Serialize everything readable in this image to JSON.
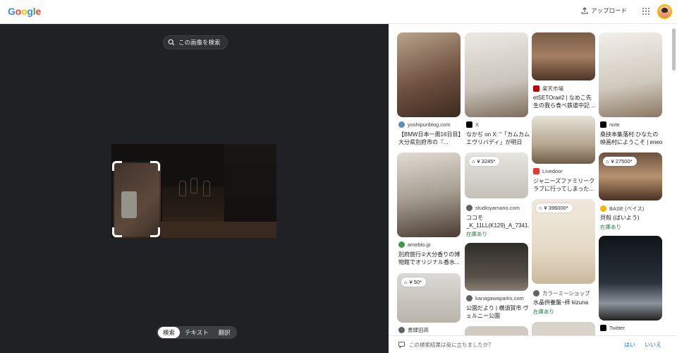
{
  "header": {
    "logo": [
      "G",
      "o",
      "o",
      "g",
      "l",
      "e"
    ],
    "logo_colors": [
      "#4285F4",
      "#EA4335",
      "#FBBC05",
      "#4285F4",
      "#34A853",
      "#EA4335"
    ],
    "upload_label": "アップロード"
  },
  "left_panel": {
    "search_image_button": "この画像を検索",
    "tabs": [
      "検索",
      "テキスト",
      "翻訳"
    ],
    "active_tab": "検索"
  },
  "results": [
    {
      "source": "yoshipuriblog.com",
      "title": "【BMW日本一周16日目】大分県別府市の『...",
      "price": "",
      "stock": ""
    },
    {
      "source": "X",
      "title": "なかぢ on X: \"「カムカムエヴリバディ」が明日最...",
      "price": "",
      "stock": ""
    },
    {
      "source": "楽天市場",
      "title": "etSETOra#2 | なめこ先生の我ら食べ鉄道中記 ...",
      "price": "",
      "stock": ""
    },
    {
      "source": "note",
      "title": "桑挟本集落村:ひなたの映画村にようこそ | eneo",
      "price": "",
      "stock": ""
    },
    {
      "source": "ameblo.jp",
      "title": "別府旅行②大分香りの博物館でオリジナル香水...",
      "price": "",
      "stock": ""
    },
    {
      "source": "studioyamano.com",
      "title": "ココモ _K_11LL(K129)_A_7341...",
      "price": "¥ 3245*",
      "stock": "在庫あり"
    },
    {
      "source": "Livedoor",
      "title": "ジャニーズファミリークラブに行ってしまった...",
      "price": "",
      "stock": ""
    },
    {
      "source": "BASE (ベイス)",
      "title": "貝殻 (ばいよう)",
      "price": "¥ 27500*",
      "stock": "在庫あり"
    },
    {
      "source": "カラーミーショップ",
      "title": "水晶供養盤~拝 kizuna",
      "price": "¥ 396000*",
      "stock": "在庫あり"
    },
    {
      "source": "kanagawaparks.com",
      "title": "公園だより | 横須賀市 ヴェルニー公園",
      "price": "",
      "stock": ""
    },
    {
      "source": "書肆田高",
      "title": "",
      "price": "¥ 50*",
      "stock": ""
    },
    {
      "source": "Twitter",
      "title": "",
      "price": "",
      "stock": ""
    }
  ],
  "feedback": {
    "question": "この検索結果は役に立ちましたか？",
    "yes": "はい",
    "no": "いいえ"
  },
  "colors": {
    "dark_bg": "#202124",
    "stock_green": "#188038",
    "link_blue": "#1a73e8"
  }
}
